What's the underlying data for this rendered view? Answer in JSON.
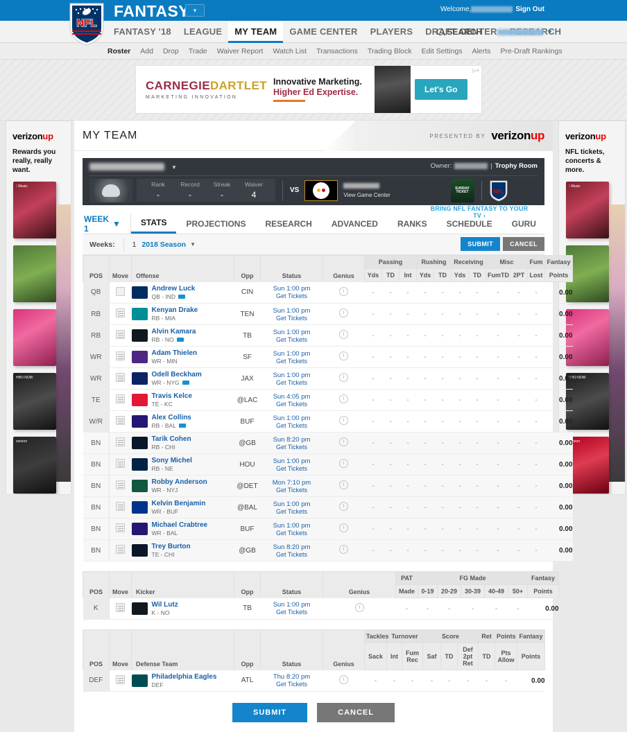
{
  "topbar": {
    "brand": "FANTASY",
    "welcome": "Welcome,",
    "signout": "Sign Out",
    "dropdown_icon": "chevron-down-icon"
  },
  "mainnav": {
    "items": [
      {
        "label": "FANTASY '18",
        "active": false
      },
      {
        "label": "LEAGUE",
        "active": false
      },
      {
        "label": "MY TEAM",
        "active": true
      },
      {
        "label": "GAME CENTER",
        "active": false
      },
      {
        "label": "PLAYERS",
        "active": false
      },
      {
        "label": "DRAFT CENTER",
        "active": false
      },
      {
        "label": "RESEARCH",
        "active": false
      }
    ],
    "search_label": "SEARCH"
  },
  "subnav": {
    "items": [
      {
        "label": "Roster",
        "active": true
      },
      {
        "label": "Add",
        "active": false
      },
      {
        "label": "Drop",
        "active": false
      },
      {
        "label": "Trade",
        "active": false
      },
      {
        "label": "Waiver Report",
        "active": false
      },
      {
        "label": "Watch List",
        "active": false
      },
      {
        "label": "Transactions",
        "active": false
      },
      {
        "label": "Trading Block",
        "active": false
      },
      {
        "label": "Edit Settings",
        "active": false
      },
      {
        "label": "Alerts",
        "active": false
      },
      {
        "label": "Pre-Draft Rankings",
        "active": false
      }
    ]
  },
  "ad": {
    "brand_a": "CARNEGIE",
    "brand_b": "DARTLET",
    "brand_sub": "MARKETING INNOVATION",
    "line1": "Innovative Marketing.",
    "line2": "Higher Ed Expertise.",
    "cta": "Let's Go",
    "disclosure": "▷×"
  },
  "sidebar_left": {
    "logo_a": "verizon",
    "logo_b": "up",
    "headline": "Rewards you really, really want."
  },
  "sidebar_right": {
    "logo_a": "verizon",
    "logo_b": "up",
    "headline": "NFL tickets, concerts & more."
  },
  "page_header": {
    "title": "MY TEAM",
    "presented_by": "PRESENTED BY",
    "sponsor_a": "verizon",
    "sponsor_b": "up"
  },
  "team_panel": {
    "owner_label": "Owner:",
    "trophy_room": "Trophy Room",
    "stats": [
      {
        "label": "Rank",
        "value": "-"
      },
      {
        "label": "Record",
        "value": "-"
      },
      {
        "label": "Streak",
        "value": "-"
      },
      {
        "label": "Waiver",
        "value": "4"
      }
    ],
    "vs": "VS",
    "view_game_center": "View Game Center",
    "sunday_ticket": "SUNDAY TICKET",
    "nfl_label": "NFL",
    "tv_link": "BRING NFL FANTASY TO YOUR TV  ›"
  },
  "tabs": {
    "week_selector": "WEEK 1",
    "items": [
      {
        "label": "STATS",
        "active": true
      },
      {
        "label": "PROJECTIONS",
        "active": false
      },
      {
        "label": "RESEARCH",
        "active": false
      },
      {
        "label": "ADVANCED",
        "active": false
      },
      {
        "label": "RANKS",
        "active": false
      },
      {
        "label": "SCHEDULE",
        "active": false
      },
      {
        "label": "GURU",
        "active": false
      }
    ]
  },
  "filter": {
    "weeks_label": "Weeks:",
    "week_number": "1",
    "season": "2018 Season",
    "submit": "SUBMIT",
    "cancel": "CANCEL"
  },
  "offense_table": {
    "group_headers": [
      {
        "label": "Passing",
        "span": 3
      },
      {
        "label": "Rushing",
        "span": 2
      },
      {
        "label": "Receiving",
        "span": 2
      },
      {
        "label": "Misc",
        "span": 2
      },
      {
        "label": "Fum",
        "span": 1
      },
      {
        "label": "Fantasy",
        "span": 1
      }
    ],
    "headers": [
      "POS",
      "Move",
      "Offense",
      "Opp",
      "Status",
      "Genius"
    ],
    "stat_headers": [
      "Yds",
      "TD",
      "Int",
      "Yds",
      "TD",
      "Yds",
      "TD",
      "FumTD",
      "2PT",
      "Lost",
      "Points"
    ],
    "rows": [
      {
        "pos": "QB",
        "name": "Andrew Luck",
        "meta": "QB - IND",
        "video": true,
        "opp": "CIN",
        "time": "Sun 1:00 pm",
        "tickets": "Get Tickets",
        "stats": [
          "-",
          "-",
          "-",
          "-",
          "-",
          "-",
          "-",
          "-",
          "-",
          "-"
        ],
        "fpts": "0.00",
        "bench": false,
        "logo": "#002c5f"
      },
      {
        "pos": "RB",
        "name": "Kenyan Drake",
        "meta": "RB - MIA",
        "video": false,
        "opp": "TEN",
        "time": "Sun 1:00 pm",
        "tickets": "Get Tickets",
        "stats": [
          "-",
          "-",
          "-",
          "-",
          "-",
          "-",
          "-",
          "-",
          "-",
          "-"
        ],
        "fpts": "0.00",
        "bench": false,
        "logo": "#008e97"
      },
      {
        "pos": "RB",
        "name": "Alvin Kamara",
        "meta": "RB - NO",
        "video": true,
        "opp": "TB",
        "time": "Sun 1:00 pm",
        "tickets": "Get Tickets",
        "stats": [
          "-",
          "-",
          "-",
          "-",
          "-",
          "-",
          "-",
          "-",
          "-",
          "-"
        ],
        "fpts": "0.00",
        "bench": false,
        "logo": "#101820"
      },
      {
        "pos": "WR",
        "name": "Adam Thielen",
        "meta": "WR - MIN",
        "video": false,
        "opp": "SF",
        "time": "Sun 1:00 pm",
        "tickets": "Get Tickets",
        "stats": [
          "-",
          "-",
          "-",
          "-",
          "-",
          "-",
          "-",
          "-",
          "-",
          "-"
        ],
        "fpts": "0.00",
        "bench": false,
        "logo": "#4f2683"
      },
      {
        "pos": "WR",
        "name": "Odell Beckham",
        "meta": "WR - NYG",
        "video": true,
        "opp": "JAX",
        "time": "Sun 1:00 pm",
        "tickets": "Get Tickets",
        "stats": [
          "-",
          "-",
          "-",
          "-",
          "-",
          "-",
          "-",
          "-",
          "-",
          "-"
        ],
        "fpts": "0.00",
        "bench": false,
        "logo": "#0b2265"
      },
      {
        "pos": "TE",
        "name": "Travis Kelce",
        "meta": "TE - KC",
        "video": false,
        "opp": "@LAC",
        "time": "Sun 4:05 pm",
        "tickets": "Get Tickets",
        "stats": [
          "-",
          "-",
          "-",
          "-",
          "-",
          "-",
          "-",
          "-",
          "-",
          "-"
        ],
        "fpts": "0.00",
        "bench": false,
        "logo": "#e31837"
      },
      {
        "pos": "W/R",
        "name": "Alex Collins",
        "meta": "RB - BAL",
        "video": true,
        "opp": "BUF",
        "time": "Sun 1:00 pm",
        "tickets": "Get Tickets",
        "stats": [
          "-",
          "-",
          "-",
          "-",
          "-",
          "-",
          "-",
          "-",
          "-",
          "-"
        ],
        "fpts": "0.00",
        "bench": false,
        "logo": "#241773"
      },
      {
        "pos": "BN",
        "name": "Tarik Cohen",
        "meta": "RB - CHI",
        "video": false,
        "opp": "@GB",
        "time": "Sun 8:20 pm",
        "tickets": "Get Tickets",
        "stats": [
          "-",
          "-",
          "-",
          "-",
          "-",
          "-",
          "-",
          "-",
          "-",
          "-"
        ],
        "fpts": "0.00",
        "bench": true,
        "logo": "#0b162a"
      },
      {
        "pos": "BN",
        "name": "Sony Michel",
        "meta": "RB - NE",
        "video": false,
        "opp": "HOU",
        "time": "Sun 1:00 pm",
        "tickets": "Get Tickets",
        "stats": [
          "-",
          "-",
          "-",
          "-",
          "-",
          "-",
          "-",
          "-",
          "-",
          "-"
        ],
        "fpts": "0.00",
        "bench": true,
        "logo": "#002244"
      },
      {
        "pos": "BN",
        "name": "Robby Anderson",
        "meta": "WR - NYJ",
        "video": false,
        "opp": "@DET",
        "time": "Mon 7:10 pm",
        "tickets": "Get Tickets",
        "stats": [
          "-",
          "-",
          "-",
          "-",
          "-",
          "-",
          "-",
          "-",
          "-",
          "-"
        ],
        "fpts": "0.00",
        "bench": true,
        "logo": "#125740"
      },
      {
        "pos": "BN",
        "name": "Kelvin Benjamin",
        "meta": "WR - BUF",
        "video": false,
        "opp": "@BAL",
        "time": "Sun 1:00 pm",
        "tickets": "Get Tickets",
        "stats": [
          "-",
          "-",
          "-",
          "-",
          "-",
          "-",
          "-",
          "-",
          "-",
          "-"
        ],
        "fpts": "0.00",
        "bench": true,
        "logo": "#00338d"
      },
      {
        "pos": "BN",
        "name": "Michael Crabtree",
        "meta": "WR - BAL",
        "video": false,
        "opp": "BUF",
        "time": "Sun 1:00 pm",
        "tickets": "Get Tickets",
        "stats": [
          "-",
          "-",
          "-",
          "-",
          "-",
          "-",
          "-",
          "-",
          "-",
          "-"
        ],
        "fpts": "0.00",
        "bench": true,
        "logo": "#241773"
      },
      {
        "pos": "BN",
        "name": "Trey Burton",
        "meta": "TE - CHI",
        "video": false,
        "opp": "@GB",
        "time": "Sun 8:20 pm",
        "tickets": "Get Tickets",
        "stats": [
          "-",
          "-",
          "-",
          "-",
          "-",
          "-",
          "-",
          "-",
          "-",
          "-"
        ],
        "fpts": "0.00",
        "bench": true,
        "logo": "#0b162a"
      }
    ]
  },
  "kicker_table": {
    "group_headers": [
      {
        "label": "PAT",
        "span": 1
      },
      {
        "label": "FG Made",
        "span": 5
      },
      {
        "label": "Fantasy",
        "span": 1
      }
    ],
    "headers": [
      "POS",
      "Move",
      "Kicker",
      "Opp",
      "Status",
      "Genius"
    ],
    "stat_headers": [
      "Made",
      "0-19",
      "20-29",
      "30-39",
      "40-49",
      "50+",
      "Points"
    ],
    "rows": [
      {
        "pos": "K",
        "name": "Wil Lutz",
        "meta": "K - NO",
        "opp": "TB",
        "time": "Sun 1:00 pm",
        "tickets": "Get Tickets",
        "stats": [
          "-",
          "-",
          "-",
          "-",
          "-",
          "-"
        ],
        "fpts": "0.00",
        "logo": "#101820"
      }
    ]
  },
  "defense_table": {
    "group_headers": [
      {
        "label": "Tackles",
        "span": 1
      },
      {
        "label": "Turnover",
        "span": 2
      },
      {
        "label": "Score",
        "span": 3
      },
      {
        "label": "Ret",
        "span": 1
      },
      {
        "label": "Points",
        "span": 1
      },
      {
        "label": "Fantasy",
        "span": 1
      }
    ],
    "headers": [
      "POS",
      "Move",
      "Defense Team",
      "Opp",
      "Status",
      "Genius"
    ],
    "stat_headers": [
      "Sack",
      "Int",
      "Fum Rec",
      "Saf",
      "TD",
      "Def 2pt Ret",
      "TD",
      "Pts Allow",
      "Points"
    ],
    "rows": [
      {
        "pos": "DEF",
        "name": "Philadelphia Eagles",
        "meta": "DEF",
        "opp": "ATL",
        "time": "Thu 8:20 pm",
        "tickets": "Get Tickets",
        "stats": [
          "-",
          "-",
          "-",
          "-",
          "-",
          "-",
          "-",
          "-"
        ],
        "fpts": "0.00",
        "logo": "#004c54"
      }
    ]
  },
  "footer_buttons": {
    "submit": "SUBMIT",
    "cancel": "CANCEL"
  },
  "colors": {
    "brand_blue": "#0a7bc0",
    "link_blue": "#1a5fa8",
    "panel_dark": "#32373d",
    "submit_blue": "#1485cd",
    "cancel_gray": "#777777"
  }
}
